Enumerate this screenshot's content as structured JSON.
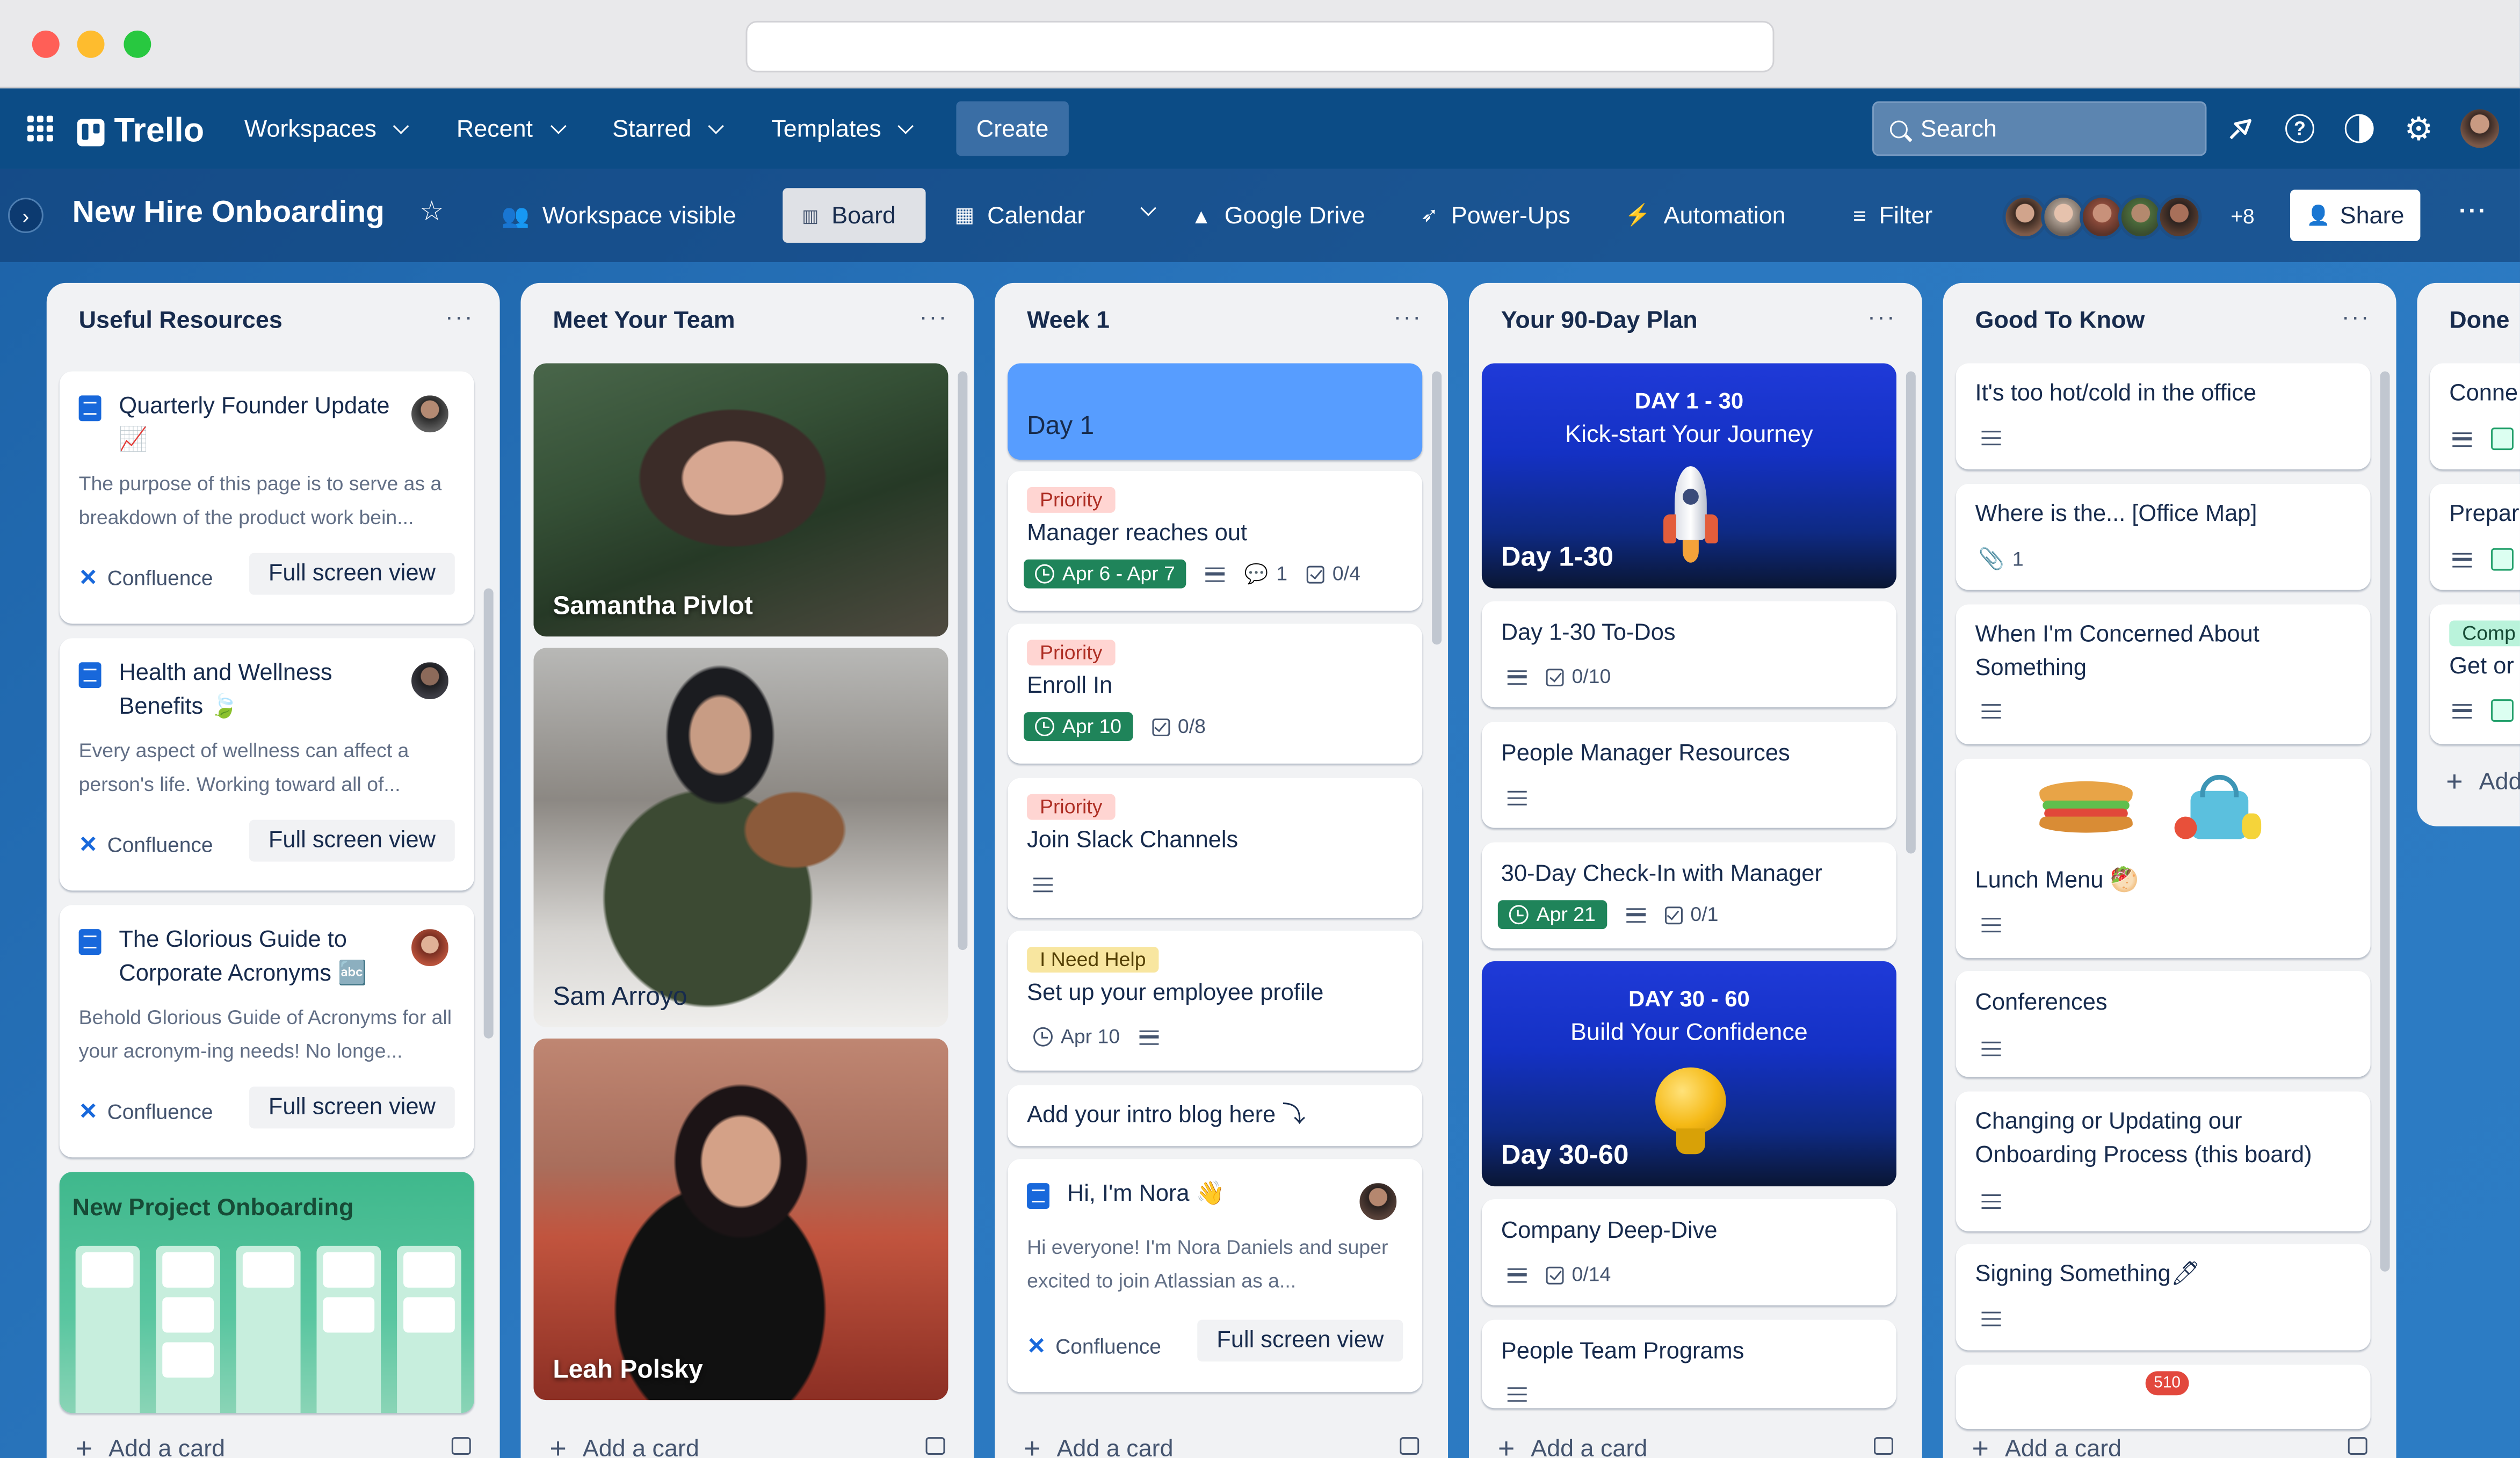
{
  "app": {
    "name": "Trello"
  },
  "topnav": {
    "items": [
      "Workspaces",
      "Recent",
      "Starred",
      "Templates"
    ],
    "create": "Create",
    "search_placeholder": "Search"
  },
  "board": {
    "title": "New Hire Onboarding",
    "visibility": "Workspace visible",
    "views": {
      "board": "Board",
      "calendar": "Calendar"
    },
    "powerups": [
      "Google Drive",
      "Power-Ups",
      "Automation"
    ],
    "filter": "Filter",
    "member_extra": "+8",
    "share": "Share"
  },
  "add_card_label": "Add a card",
  "lists": [
    {
      "title": "Useful Resources",
      "cards": [
        {
          "title": "Quarterly Founder Update 📈",
          "excerpt": "The purpose of this page is to serve as a breakdown of the product work bein...",
          "source": "Confluence",
          "action": "Full screen view"
        },
        {
          "title": "Health and Wellness Benefits 🍃",
          "excerpt": "Every aspect of wellness can affect a person's life. Working toward all of...",
          "source": "Confluence",
          "action": "Full screen view"
        },
        {
          "title": "The Glorious Guide to Corporate Acronyms 🔤",
          "excerpt": "Behold Glorious Guide of Acronyms for all your acronym-ing needs! No longe...",
          "source": "Confluence",
          "action": "Full screen view"
        },
        {
          "title": "New Project Onboarding"
        }
      ]
    },
    {
      "title": "Meet Your Team",
      "cards": [
        {
          "title": "Samantha Pivlot"
        },
        {
          "title": "Sam Arroyo"
        },
        {
          "title": "Leah Polsky"
        }
      ]
    },
    {
      "title": "Week 1",
      "cards": [
        {
          "title": "Day 1"
        },
        {
          "label": "Priority",
          "title": "Manager reaches out",
          "due": "Apr 6 - Apr 7",
          "comments": "1",
          "checklist": "0/4"
        },
        {
          "label": "Priority",
          "title": "Enroll In",
          "due": "Apr 10",
          "checklist": "0/8"
        },
        {
          "label": "Priority",
          "title": "Join Slack Channels"
        },
        {
          "label": "I Need Help",
          "title": "Set up your employee profile",
          "due": "Apr 10"
        },
        {
          "title": "Add your intro blog here ⤵"
        },
        {
          "title": "Hi, I'm Nora 👋",
          "excerpt": "Hi everyone! I'm Nora Daniels and super excited to join Atlassian as a...",
          "source": "Confluence",
          "action": "Full screen view"
        }
      ]
    },
    {
      "title": "Your 90-Day Plan",
      "cards": [
        {
          "cover_heading": "DAY 1 - 30",
          "cover_sub": "Kick-start Your Journey",
          "title": "Day 1-30"
        },
        {
          "title": "Day 1-30 To-Dos",
          "checklist": "0/10"
        },
        {
          "title": "People Manager Resources"
        },
        {
          "title": "30-Day Check-In with Manager",
          "due": "Apr 21",
          "checklist": "0/1"
        },
        {
          "cover_heading": "DAY 30 - 60",
          "cover_sub": "Build Your Confidence",
          "title": "Day 30-60"
        },
        {
          "title": "Company Deep-Dive",
          "checklist": "0/14"
        },
        {
          "title": "People Team Programs"
        }
      ]
    },
    {
      "title": "Good To Know",
      "cards": [
        {
          "title": "It's too hot/cold in the office"
        },
        {
          "title": "Where is the... [Office Map]",
          "attachments": "1"
        },
        {
          "title": "When I'm Concerned About Something"
        },
        {
          "title": "Lunch Menu 🥙"
        },
        {
          "title": "Conferences"
        },
        {
          "title": "Changing or Updating our Onboarding Process (this board)"
        },
        {
          "title": "Signing Something🖊"
        },
        {
          "notification": "510"
        }
      ]
    },
    {
      "title": "Done",
      "cards": [
        {
          "title": "Conne"
        },
        {
          "title": "Prepar"
        },
        {
          "label": "Comp",
          "title": "Get or"
        }
      ],
      "add_partial": "Add"
    }
  ],
  "colors": {
    "nav": "#0c4c86",
    "accent": "#1868db",
    "due_green": "#1f845a"
  }
}
